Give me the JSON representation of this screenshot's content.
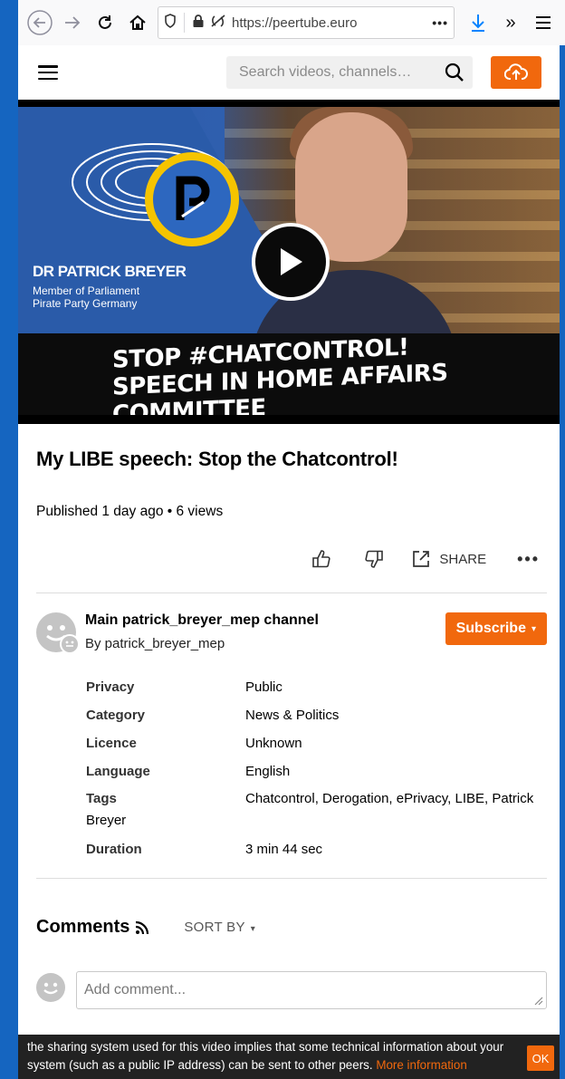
{
  "browser": {
    "url": "https://peertube.euro",
    "more_dots": "•••",
    "overflow": "»"
  },
  "header": {
    "search_placeholder": "Search videos, channels…"
  },
  "video": {
    "overlay_name": "DR PATRICK BREYER",
    "overlay_role": "Member of Parliament\nPirate Party Germany",
    "overlay_banner": "STOP #CHATCONTROL!\nSPEECH IN HOME AFFAIRS COMMITTEE",
    "title": "My LIBE speech: Stop the Chatcontrol!",
    "published": "Published 1 day ago • 6 views"
  },
  "actions": {
    "share_label": "SHARE",
    "more": "•••"
  },
  "channel": {
    "name": "Main patrick_breyer_mep channel",
    "by": "By patrick_breyer_mep",
    "subscribe_label": "Subscribe",
    "subscribe_caret": "▾"
  },
  "meta": {
    "privacy_label": "Privacy",
    "privacy_value": "Public",
    "category_label": "Category",
    "category_value": "News & Politics",
    "licence_label": "Licence",
    "licence_value": "Unknown",
    "language_label": "Language",
    "language_value": "English",
    "tags_label": "Tags",
    "tags_value": "Chatcontrol, Derogation, ePrivacy, LIBE, Patrick Breyer",
    "duration_label": "Duration",
    "duration_value": "3 min 44 sec"
  },
  "comments": {
    "title": "Comments",
    "sort_label": "SORT BY",
    "sort_caret": "▾",
    "add_placeholder": "Add comment..."
  },
  "cookie": {
    "text": "the sharing system used for this video implies that some technical information about your system (such as a public IP address) can be sent to other peers. ",
    "link": "More information",
    "ok": "OK"
  },
  "colors": {
    "accent": "#f1680d",
    "browser_blue": "#1565c0",
    "download_blue": "#0a84ff"
  }
}
